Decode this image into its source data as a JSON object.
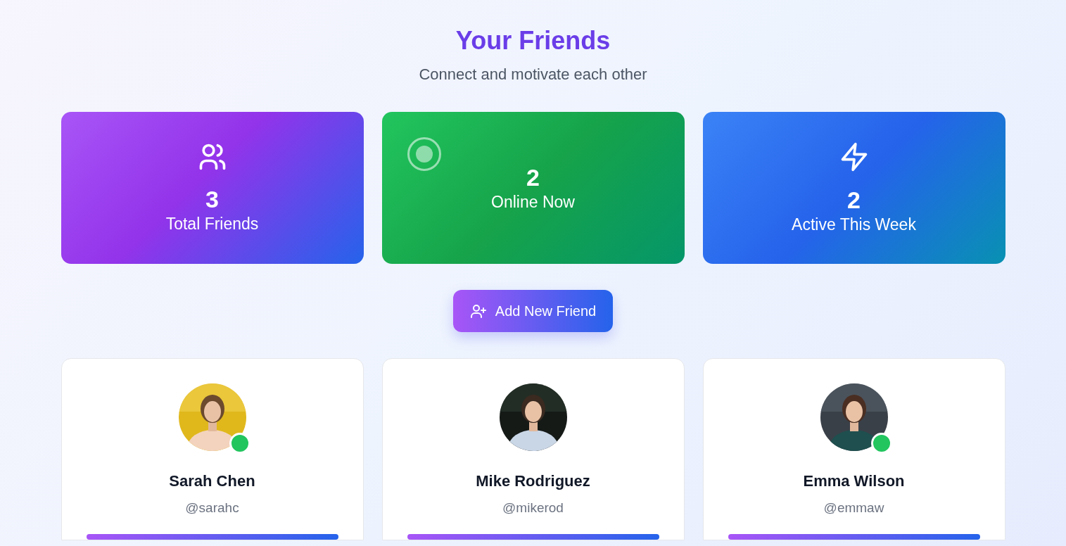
{
  "header": {
    "title": "Your Friends",
    "subtitle": "Connect and motivate each other"
  },
  "stats": [
    {
      "kind": "users",
      "value": "3",
      "label": "Total Friends"
    },
    {
      "kind": "online",
      "value": "2",
      "label": "Online Now"
    },
    {
      "kind": "bolt",
      "value": "2",
      "label": "Active This Week"
    }
  ],
  "add_button": {
    "label": "Add New Friend"
  },
  "friends": [
    {
      "name": "Sarah Chen",
      "handle": "@sarahc",
      "online": true
    },
    {
      "name": "Mike Rodriguez",
      "handle": "@mikerod",
      "online": false
    },
    {
      "name": "Emma Wilson",
      "handle": "@emmaw",
      "online": true
    }
  ]
}
